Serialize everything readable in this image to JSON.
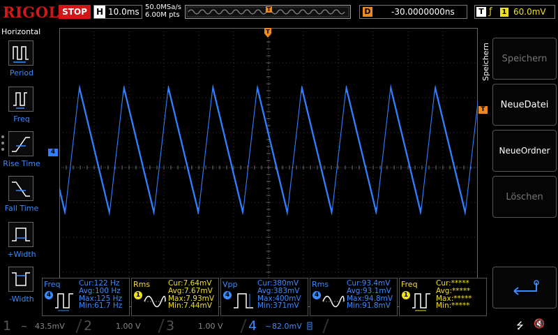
{
  "topbar": {
    "logo": "RIGOL",
    "run_state": "STOP",
    "horizontal_label": "H",
    "timebase": "10.0ms",
    "sample_rate": "50.0MSa/s",
    "memory_depth": "6.00M pts",
    "timeline_marker": "T",
    "delay_label": "D",
    "delay_value": "-30.0000000ns",
    "trigger_label": "T",
    "trigger_source": "1",
    "trigger_level": "60.0mV"
  },
  "left_menu": {
    "title": "Horizontal",
    "items": [
      {
        "label": "Period",
        "icon": "period-icon"
      },
      {
        "label": "Freq",
        "icon": "freq-icon"
      },
      {
        "label": "Rise Time",
        "icon": "rise-time-icon"
      },
      {
        "label": "Fall Time",
        "icon": "fall-time-icon"
      },
      {
        "label": "+Width",
        "icon": "pos-width-icon"
      },
      {
        "label": "-Width",
        "icon": "neg-width-icon"
      }
    ]
  },
  "markers": {
    "ch4_ground": "4",
    "trigger_level_marker": "T",
    "trigger_position": "T"
  },
  "right_menu": {
    "tab_label": "Speichern",
    "buttons": [
      {
        "label": "Speichern",
        "enabled": false
      },
      {
        "label": "NeueDatei",
        "enabled": true
      },
      {
        "label": "NeueOrdner",
        "enabled": true
      },
      {
        "label": "Löschen",
        "enabled": false
      }
    ],
    "back_icon": "return-arrow-icon"
  },
  "measurements": [
    {
      "name": "Freq",
      "channel": "4",
      "color": "#3a8bff",
      "cur": "Cur:122 Hz",
      "avg": "Avg:100 Hz",
      "max": "Max:125 Hz",
      "min": "Min:61.7 Hz"
    },
    {
      "name": "Rms",
      "channel": "1",
      "color": "#f0e020",
      "cur": "Cur:7.64mV",
      "avg": "Avg:7.67mV",
      "max": "Max:7.93mV",
      "min": "Min:7.44mV"
    },
    {
      "name": "Vpp",
      "channel": "4",
      "color": "#3a8bff",
      "cur": "Cur:380mV",
      "avg": "Avg:383mV",
      "max": "Max:400mV",
      "min": "Min:371mV"
    },
    {
      "name": "Rms",
      "channel": "4",
      "color": "#3a8bff",
      "cur": "Cur:93.4mV",
      "avg": "Avg:93.1mV",
      "max": "Max:94.8mV",
      "min": "Min:91.8mV"
    },
    {
      "name": "Freq",
      "channel": "1",
      "color": "#f0e020",
      "cur": "Cur:*****",
      "avg": "Avg:*****",
      "max": "Max:*****",
      "min": "Min:*****"
    }
  ],
  "channels": [
    {
      "num": "1",
      "value": "43.5mV",
      "coupling": "~"
    },
    {
      "num": "2",
      "value": "1.00 V",
      "coupling": ""
    },
    {
      "num": "3",
      "value": "1.00 V",
      "coupling": ""
    },
    {
      "num": "4",
      "value": "82.0mV",
      "coupling": "~"
    }
  ],
  "waveform": {
    "channel": "4",
    "color": "#2f7fff",
    "shape": "sawtooth",
    "period_divisions": 0.85
  }
}
